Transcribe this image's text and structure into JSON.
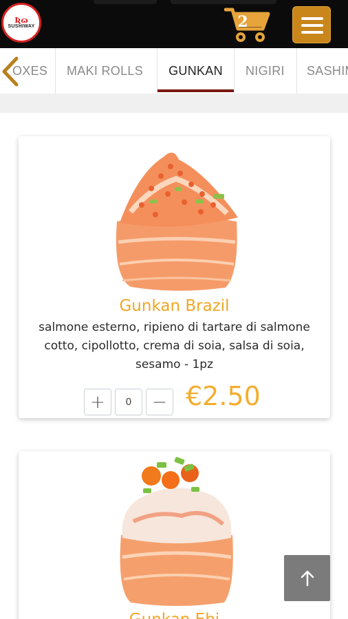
{
  "header": {
    "logo_mark": "Ʀɷ",
    "logo_text": "SUSHIWAY",
    "cart_count": "2",
    "icons": {
      "cart": "shopping-cart-icon",
      "menu": "hamburger-menu-icon",
      "logo": "sushiway-logo-icon"
    }
  },
  "category_tabs": {
    "items": [
      {
        "label": "OXES",
        "active": false
      },
      {
        "label": "MAKI ROLLS",
        "active": false
      },
      {
        "label": "GUNKAN",
        "active": true
      },
      {
        "label": "NIGIRI",
        "active": false
      },
      {
        "label": "SASHIMI",
        "active": false
      }
    ],
    "back_icon": "chevron-left-icon"
  },
  "products": [
    {
      "name": "Gunkan Brazil",
      "description": "salmone esterno, ripieno di tartare di salmone cotto, cipollotto, crema di soia, salsa di soia, sesamo - 1pz",
      "quantity": "0",
      "price": "€2.50",
      "plus_label": "+",
      "minus_label": "−"
    },
    {
      "name": "Gunkan Ebi"
    }
  ],
  "scroll_top_icon": "arrow-up-icon",
  "colors": {
    "accent": "#f0a623",
    "price": "#f4ad2e",
    "header_bg": "#0b0b0b",
    "menu_button": "#c8861b",
    "active_tab_underline": "#7a1a10",
    "logo_red": "#d62020"
  }
}
